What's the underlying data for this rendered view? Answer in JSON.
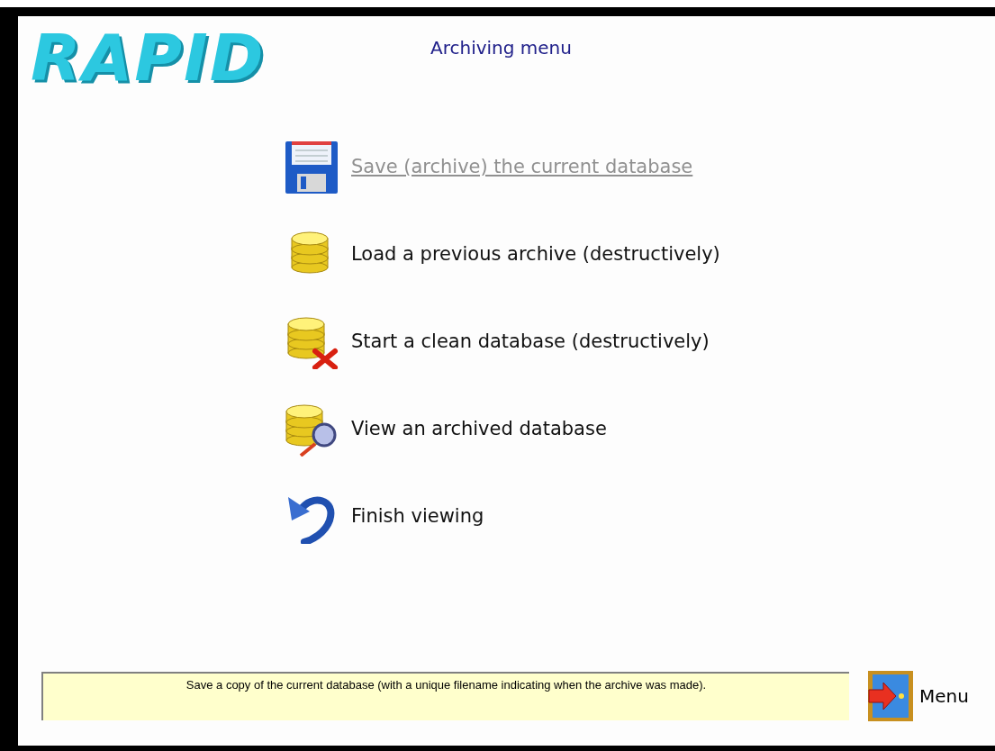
{
  "logo": {
    "text": "RAPID"
  },
  "header": {
    "title": "Archiving menu"
  },
  "menu_items": [
    {
      "kind": "save",
      "label": "Save (archive) the current database",
      "highlighted": true
    },
    {
      "kind": "load",
      "label": "Load a previous archive (destructively)",
      "highlighted": false
    },
    {
      "kind": "clean",
      "label": "Start a clean database (destructively)",
      "highlighted": false
    },
    {
      "kind": "view",
      "label": "View an archived database",
      "highlighted": false
    },
    {
      "kind": "finish",
      "label": "Finish viewing",
      "highlighted": false
    }
  ],
  "status_box": {
    "text": "Save a copy of the current database (with a unique filename indicating when the archive was made)."
  },
  "menu_button": {
    "label": "Menu"
  }
}
